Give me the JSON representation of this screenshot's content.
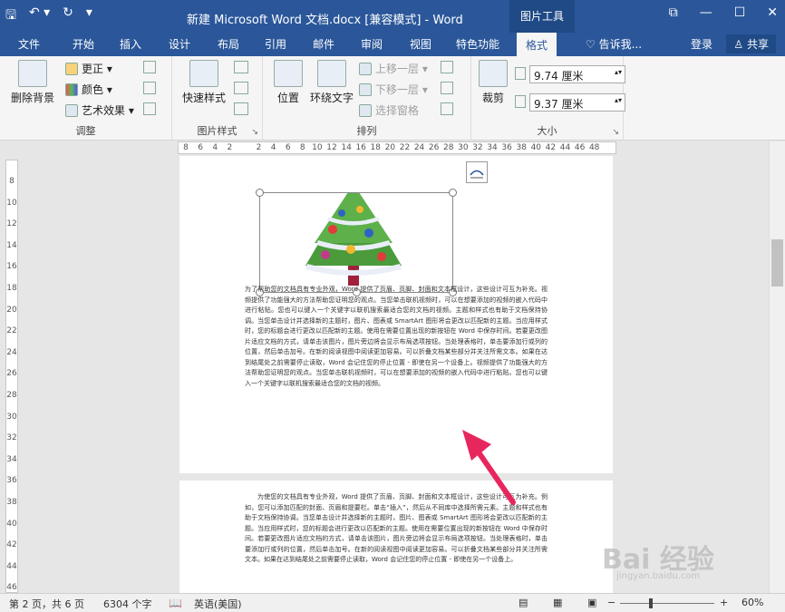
{
  "titlebar": {
    "title": "新建 Microsoft Word 文档.docx [兼容模式] - Word",
    "context_tab": "图片工具",
    "qat": {
      "save": "🖫",
      "undo": "↶ ▾",
      "redo": "↻",
      "customize": "▾"
    },
    "winbtns": {
      "restore_ribbon": "⧉",
      "minimize": "—",
      "maximize": "☐",
      "close": "✕"
    }
  },
  "tabs": {
    "items": [
      "文件",
      "开始",
      "插入",
      "设计",
      "布局",
      "引用",
      "邮件",
      "审阅",
      "视图",
      "特色功能",
      "格式"
    ],
    "tell_me": "♡ 告诉我...",
    "login": "登录",
    "share": "♙ 共享"
  },
  "ribbon": {
    "adjust": {
      "label": "调整",
      "remove_bg": "删除背景",
      "corrections": "更正 ▾",
      "color": "颜色 ▾",
      "artistic": "艺术效果 ▾"
    },
    "styles": {
      "label": "图片样式",
      "quick_styles": "快速样式"
    },
    "arrange": {
      "label": "排列",
      "position": "位置",
      "wrap_text": "环绕文字",
      "bring_forward": "上移一层 ▾",
      "send_backward": "下移一层 ▾",
      "selection_pane": "选择窗格"
    },
    "size": {
      "label": "大小",
      "crop": "裁剪",
      "height": "9.74 厘米",
      "width": "9.37 厘米",
      "spinner": "▴▾"
    },
    "launcher": "↘"
  },
  "ruler": {
    "h_marks": [
      "8",
      "6",
      "4",
      "2",
      "",
      "2",
      "4",
      "6",
      "8",
      "10",
      "12",
      "14",
      "16",
      "18",
      "20",
      "22",
      "24",
      "26",
      "28",
      "30",
      "32",
      "34",
      "36",
      "38",
      "40",
      "42",
      "44",
      "46",
      "48"
    ],
    "v_marks": [
      "8",
      "10",
      "12",
      "14",
      "16",
      "18",
      "20",
      "22",
      "24",
      "26",
      "28",
      "30",
      "32",
      "34",
      "36",
      "38",
      "40",
      "42",
      "44",
      "46"
    ]
  },
  "document": {
    "para1": "为了帮助您的文档具有专业外观，Word 提供了页眉、页脚、封面和文本框设计，这些设计可互为补充。视频提供了功能强大的方法帮助您证明您的观点。当您单击联机视频时，可以在想要添加的视频的嵌入代码中进行粘贴。您也可以键入一个关键字以联机搜索最适合您的文档的视频。主题和样式也有助于文档保持协调。当您单击设计并选择新的主题时，图片、图表或 SmartArt 图形将会更改以匹配新的主题。当应用样式时，您的标题会进行更改以匹配新的主题。使用在需要位置出现的新按钮在 Word 中保存时间。若要更改图片适应文档的方式，请单击该图片，图片旁边将会显示布局选项按钮。当处理表格时，单击要添加行或列的位置，然后单击加号。在新的阅读视图中阅读更加容易。可以折叠文档某些部分并关注所需文本。如果在达到结尾处之前需要停止读取，Word 会记住您的停止位置 - 即使在另一个设备上。视频提供了功能强大的方法帮助您证明您的观点。当您单击联机视频时，可以在想要添加的视频的嵌入代码中进行粘贴。您也可以键入一个关键字以联机搜索最适合您的文档的视频。",
    "para2": "为使您的文档具有专业外观，Word 提供了页眉、页脚、封面和文本框设计，这些设计可互为补充。例如，您可以添加匹配的封面、页眉和提要栏。单击“插入”，然后从不同库中选择所需元素。主题和样式也有助于文档保持协调。当您单击设计并选择新的主题时，图片、图表或 SmartArt 图形将会更改以匹配新的主题。当应用样式时，您的标题会进行更改以匹配新的主题。使用在需要位置出现的新按钮在 Word 中保存时间。若要更改图片适应文档的方式，请单击该图片，图片旁边将会显示布局选项按钮。当处理表格时，单击要添加行或列的位置，然后单击加号。在新的阅读视图中阅读更加容易。可以折叠文档某些部分并关注所需文本。如果在达到结尾处之前需要停止读取，Word 会记住您的停止位置 - 即使在另一个设备上。"
  },
  "status": {
    "page": "第 2 页，共 6 页",
    "words": "6304 个字",
    "lang": "英语(美国)",
    "zoom": "60%",
    "zoom_minus": "−",
    "zoom_plus": "+"
  },
  "watermark": {
    "main": "Bai 经验",
    "sub": "jingyan.baidu.com"
  },
  "colors": {
    "brand": "#2b579a",
    "arrow": "#e8265e"
  }
}
